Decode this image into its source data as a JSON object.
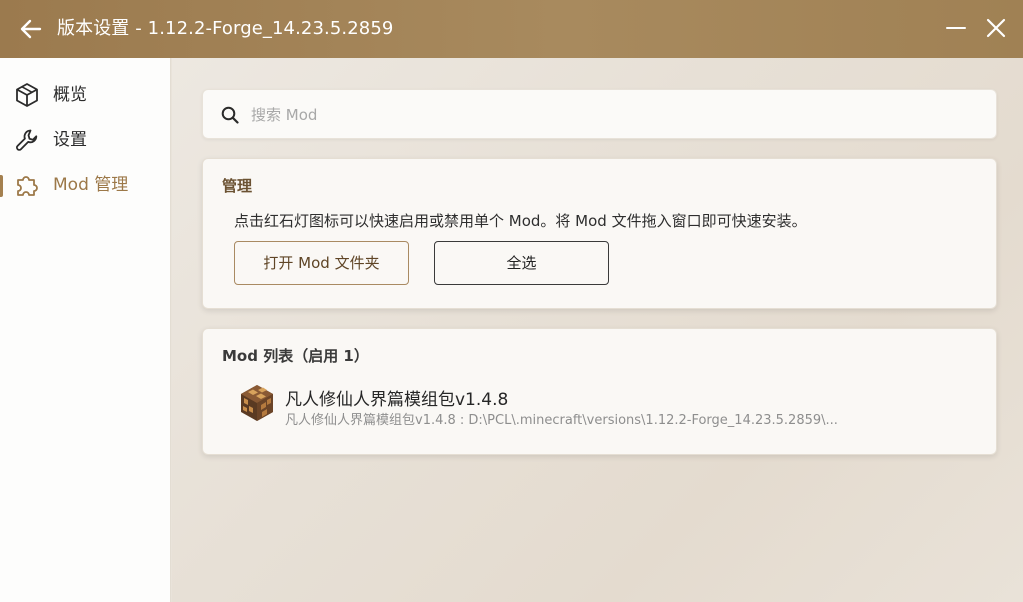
{
  "window": {
    "title": "版本设置 - 1.12.2-Forge_14.23.5.2859"
  },
  "sidebar": {
    "items": [
      {
        "label": "概览",
        "icon": "cube-icon",
        "active": false
      },
      {
        "label": "设置",
        "icon": "wrench-icon",
        "active": false
      },
      {
        "label": "Mod 管理",
        "icon": "puzzle-icon",
        "active": true
      }
    ]
  },
  "search": {
    "placeholder": "搜索 Mod",
    "value": ""
  },
  "manage": {
    "title": "管理",
    "description": "点击红石灯图标可以快速启用或禁用单个 Mod。将 Mod 文件拖入窗口即可快速安装。",
    "open_folder_label": "打开 Mod 文件夹",
    "select_all_label": "全选"
  },
  "mod_list": {
    "title": "Mod 列表（启用 1）",
    "items": [
      {
        "name": "凡人修仙人界篇模组包v1.4.8",
        "path": "凡人修仙人界篇模组包v1.4.8 : D:\\PCL\\.minecraft\\versions\\1.12.2-Forge_14.23.5.2859\\...",
        "icon": "redstone-lamp-icon"
      }
    ]
  },
  "colors": {
    "accent": "#a4804f",
    "titlebar": "#a08154",
    "sidebar_bg": "#fdfdfc",
    "card_bg": "#faf8f5"
  }
}
